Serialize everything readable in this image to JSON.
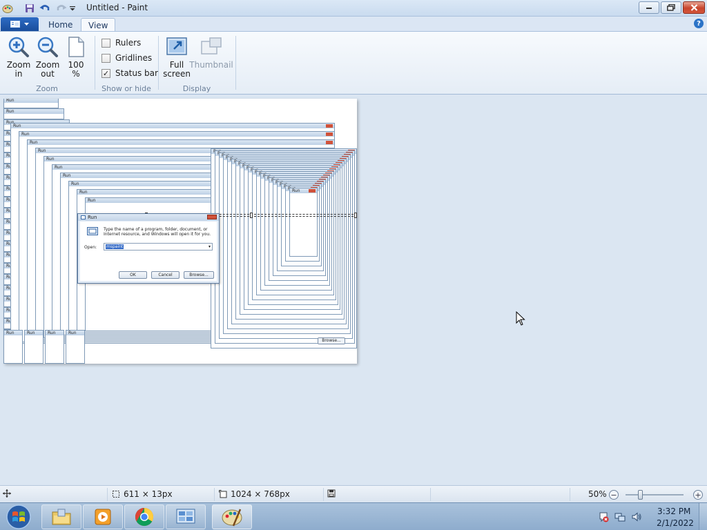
{
  "window": {
    "title": "Untitled - Paint"
  },
  "ribbon": {
    "tabs": {
      "home": "Home",
      "view": "View"
    },
    "help": "?",
    "zoom_group": {
      "label": "Zoom",
      "zoom_in_1": "Zoom",
      "zoom_in_2": "in",
      "zoom_out_1": "Zoom",
      "zoom_out_2": "out",
      "hundred_1": "100",
      "hundred_2": "%"
    },
    "show_hide_group": {
      "label": "Show or hide",
      "rulers": {
        "label": "Rulers",
        "checked": false
      },
      "gridlines": {
        "label": "Gridlines",
        "checked": false
      },
      "status_bar": {
        "label": "Status bar",
        "checked": true
      }
    },
    "display_group": {
      "label": "Display",
      "full_screen_1": "Full",
      "full_screen_2": "screen",
      "thumbnail": "Thumbnail"
    }
  },
  "canvas": {
    "run_dialog": {
      "title": "Run",
      "description": "Type the name of a program, folder, document, or Internet resource, and Windows will open it for you.",
      "open_label": "Open:",
      "open_value": "mspaint",
      "ok": "OK",
      "cancel": "Cancel",
      "browse": "Browse..."
    },
    "echo_label": "Run",
    "echo_browse": "Browse..."
  },
  "statusbar": {
    "selection_size": "611 × 13px",
    "image_size": "1024 × 768px",
    "zoom": "50%"
  },
  "taskbar": {
    "time": "3:32 PM",
    "date": "2/1/2022"
  },
  "colors": {
    "accent": "#2b6cc4",
    "close": "#c8452c",
    "selection": "#3168c6"
  }
}
